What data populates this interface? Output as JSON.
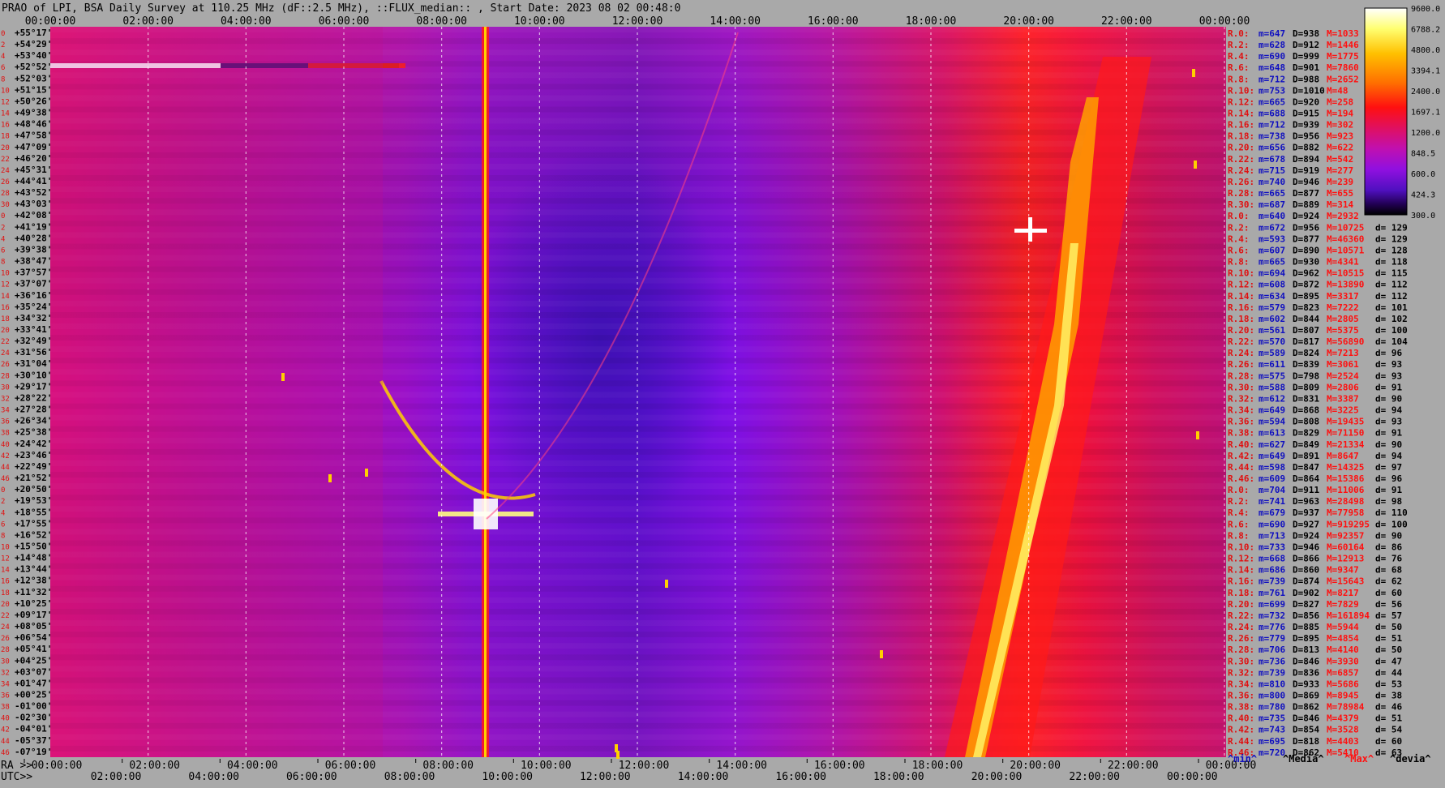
{
  "title": "PRAO of LPI, BSA Daily Survey at 110.25 MHz (dF::2.5 MHz), ::FLUX_median:: , Start Date: 2023 08 02 00:48:0",
  "chart_data": {
    "type": "heatmap",
    "title": "PRAO of LPI, BSA Daily Survey at 110.25 MHz (dF::2.5 MHz), ::FLUX_median:: , Start Date: 2023 08 02 00:48:0",
    "top_axis_ticks": [
      "00:00:00",
      "02:00:00",
      "04:00:00",
      "06:00:00",
      "08:00:00",
      "10:00:00",
      "12:00:00",
      "14:00:00",
      "16:00:00",
      "18:00:00",
      "20:00:00",
      "22:00:00",
      "00:00:00"
    ],
    "bottom_axis_ra_label": "RA >>",
    "bottom_axis_ra_ticks": [
      "00:00:00",
      "02:00:00",
      "04:00:00",
      "06:00:00",
      "08:00:00",
      "10:00:00",
      "12:00:00",
      "14:00:00",
      "16:00:00",
      "18:00:00",
      "20:00:00",
      "22:00:00",
      "00:00:00"
    ],
    "bottom_axis_utc_label": "UTC>>",
    "bottom_axis_utc_ticks": [
      "02:00:00",
      "04:00:00",
      "06:00:00",
      "08:00:00",
      "10:00:00",
      "12:00:00",
      "14:00:00",
      "16:00:00",
      "18:00:00",
      "20:00:00",
      "22:00:00",
      "00:00:00"
    ],
    "declinations": [
      "+55°17'",
      "+54°29'",
      "+53°40'",
      "+52°52'",
      "+52°03'",
      "+51°15'",
      "+50°26'",
      "+49°38'",
      "+48°46'",
      "+47°58'",
      "+47°09'",
      "+46°20'",
      "+45°31'",
      "+44°41'",
      "+43°52'",
      "+43°03'",
      "+42°08'",
      "+41°19'",
      "+40°28'",
      "+39°38'",
      "+38°47'",
      "+37°57'",
      "+37°07'",
      "+36°16'",
      "+35°24'",
      "+34°32'",
      "+33°41'",
      "+32°49'",
      "+31°56'",
      "+31°04'",
      "+30°10'",
      "+29°17'",
      "+28°22'",
      "+27°28'",
      "+26°34'",
      "+25°38'",
      "+24°42'",
      "+23°46'",
      "+22°49'",
      "+21°52'",
      "+20°50'",
      "+19°53'",
      "+18°55'",
      "+17°55'",
      "+16°52'",
      "+15°50'",
      "+14°48'",
      "+13°44'",
      "+12°38'",
      "+11°32'",
      "+10°25'",
      "+09°17'",
      "+08°05'",
      "+06°54'",
      "+05°41'",
      "+04°25'",
      "+03°07'",
      "+01°47'",
      "+00°25'",
      "-01°00'",
      "-02°30'",
      "-04°01'",
      "-05°37'",
      "-07°19'"
    ],
    "row_indices": [
      "0",
      "2",
      "4",
      "6",
      "8",
      "10",
      "12",
      "14",
      "16",
      "18",
      "20",
      "22",
      "24",
      "26",
      "28",
      "30",
      "0",
      "2",
      "4",
      "6",
      "8",
      "10",
      "12",
      "14",
      "16",
      "18",
      "20",
      "22",
      "24",
      "26",
      "28",
      "30",
      "32",
      "34",
      "36",
      "38",
      "40",
      "42",
      "44",
      "46",
      "0",
      "2",
      "4",
      "6",
      "8",
      "10",
      "12",
      "14",
      "16",
      "18",
      "20",
      "22",
      "24",
      "26",
      "28",
      "30",
      "32",
      "34",
      "36",
      "38",
      "40",
      "42",
      "44",
      "46"
    ],
    "colorbar": {
      "ticks": [
        "9600.0",
        "6788.2",
        "4800.0",
        "3394.1",
        "2400.0",
        "1697.1",
        "1200.0",
        "848.5",
        "600.0",
        "424.3",
        "300.0"
      ],
      "min": 300.0,
      "max": 9600.0,
      "colors": [
        "#ffffff",
        "#ffff70",
        "#ffc000",
        "#ff7000",
        "#ff1010",
        "#e01060",
        "#c010b0",
        "#9010e0",
        "#5010c0",
        "#200050",
        "#000000"
      ]
    },
    "stats_rows": [
      {
        "r": "R.0:",
        "m": "m=647",
        "d": "D=938",
        "x": "M=1033",
        "dev": ""
      },
      {
        "r": "R.2:",
        "m": "m=628",
        "d": "D=912",
        "x": "M=1446",
        "dev": ""
      },
      {
        "r": "R.4:",
        "m": "m=690",
        "d": "D=999",
        "x": "M=1775",
        "dev": ""
      },
      {
        "r": "R.6:",
        "m": "m=648",
        "d": "D=901",
        "x": "M=7860",
        "dev": ""
      },
      {
        "r": "R.8:",
        "m": "m=712",
        "d": "D=988",
        "x": "M=2652",
        "dev": ""
      },
      {
        "r": "R.10:",
        "m": "m=753",
        "d": "D=1010",
        "x": "M=48",
        "dev": ""
      },
      {
        "r": "R.12:",
        "m": "m=665",
        "d": "D=920",
        "x": "M=258",
        "dev": ""
      },
      {
        "r": "R.14:",
        "m": "m=688",
        "d": "D=915",
        "x": "M=194",
        "dev": ""
      },
      {
        "r": "R.16:",
        "m": "m=712",
        "d": "D=939",
        "x": "M=302",
        "dev": ""
      },
      {
        "r": "R.18:",
        "m": "m=738",
        "d": "D=956",
        "x": "M=923",
        "dev": ""
      },
      {
        "r": "R.20:",
        "m": "m=656",
        "d": "D=882",
        "x": "M=622",
        "dev": ""
      },
      {
        "r": "R.22:",
        "m": "m=678",
        "d": "D=894",
        "x": "M=542",
        "dev": ""
      },
      {
        "r": "R.24:",
        "m": "m=715",
        "d": "D=919",
        "x": "M=277",
        "dev": ""
      },
      {
        "r": "R.26:",
        "m": "m=740",
        "d": "D=946",
        "x": "M=239",
        "dev": ""
      },
      {
        "r": "R.28:",
        "m": "m=665",
        "d": "D=877",
        "x": "M=655",
        "dev": ""
      },
      {
        "r": "R.30:",
        "m": "m=687",
        "d": "D=889",
        "x": "M=314",
        "dev": ""
      },
      {
        "r": "R.0:",
        "m": "m=640",
        "d": "D=924",
        "x": "M=2932",
        "dev": ""
      },
      {
        "r": "R.2:",
        "m": "m=672",
        "d": "D=956",
        "x": "M=10725",
        "dev": "d= 129"
      },
      {
        "r": "R.4:",
        "m": "m=593",
        "d": "D=877",
        "x": "M=46360",
        "dev": "d= 129"
      },
      {
        "r": "R.6:",
        "m": "m=607",
        "d": "D=890",
        "x": "M=10571",
        "dev": "d= 128"
      },
      {
        "r": "R.8:",
        "m": "m=665",
        "d": "D=930",
        "x": "M=4341",
        "dev": "d= 118"
      },
      {
        "r": "R.10:",
        "m": "m=694",
        "d": "D=962",
        "x": "M=10515",
        "dev": "d= 115"
      },
      {
        "r": "R.12:",
        "m": "m=608",
        "d": "D=872",
        "x": "M=13890",
        "dev": "d= 112"
      },
      {
        "r": "R.14:",
        "m": "m=634",
        "d": "D=895",
        "x": "M=3317",
        "dev": "d= 112"
      },
      {
        "r": "R.16:",
        "m": "m=579",
        "d": "D=823",
        "x": "M=7222",
        "dev": "d= 101"
      },
      {
        "r": "R.18:",
        "m": "m=602",
        "d": "D=844",
        "x": "M=2805",
        "dev": "d= 102"
      },
      {
        "r": "R.20:",
        "m": "m=561",
        "d": "D=807",
        "x": "M=5375",
        "dev": "d= 100"
      },
      {
        "r": "R.22:",
        "m": "m=570",
        "d": "D=817",
        "x": "M=56890",
        "dev": "d= 104"
      },
      {
        "r": "R.24:",
        "m": "m=589",
        "d": "D=824",
        "x": "M=7213",
        "dev": "d= 96"
      },
      {
        "r": "R.26:",
        "m": "m=611",
        "d": "D=839",
        "x": "M=3061",
        "dev": "d= 93"
      },
      {
        "r": "R.28:",
        "m": "m=575",
        "d": "D=798",
        "x": "M=2524",
        "dev": "d= 93"
      },
      {
        "r": "R.30:",
        "m": "m=588",
        "d": "D=809",
        "x": "M=2806",
        "dev": "d= 91"
      },
      {
        "r": "R.32:",
        "m": "m=612",
        "d": "D=831",
        "x": "M=3387",
        "dev": "d= 90"
      },
      {
        "r": "R.34:",
        "m": "m=649",
        "d": "D=868",
        "x": "M=3225",
        "dev": "d= 94"
      },
      {
        "r": "R.36:",
        "m": "m=594",
        "d": "D=808",
        "x": "M=19435",
        "dev": "d= 93"
      },
      {
        "r": "R.38:",
        "m": "m=613",
        "d": "D=829",
        "x": "M=71150",
        "dev": "d= 91"
      },
      {
        "r": "R.40:",
        "m": "m=627",
        "d": "D=849",
        "x": "M=21334",
        "dev": "d= 90"
      },
      {
        "r": "R.42:",
        "m": "m=649",
        "d": "D=891",
        "x": "M=8647",
        "dev": "d= 94"
      },
      {
        "r": "R.44:",
        "m": "m=598",
        "d": "D=847",
        "x": "M=14325",
        "dev": "d= 97"
      },
      {
        "r": "R.46:",
        "m": "m=609",
        "d": "D=864",
        "x": "M=15386",
        "dev": "d= 96"
      },
      {
        "r": "R.0:",
        "m": "m=704",
        "d": "D=911",
        "x": "M=11006",
        "dev": "d= 91"
      },
      {
        "r": "R.2:",
        "m": "m=741",
        "d": "D=963",
        "x": "M=28498",
        "dev": "d= 98"
      },
      {
        "r": "R.4:",
        "m": "m=679",
        "d": "D=937",
        "x": "M=77958",
        "dev": "d= 110"
      },
      {
        "r": "R.6:",
        "m": "m=690",
        "d": "D=927",
        "x": "M=919295",
        "dev": "d= 100"
      },
      {
        "r": "R.8:",
        "m": "m=713",
        "d": "D=924",
        "x": "M=92357",
        "dev": "d= 90"
      },
      {
        "r": "R.10:",
        "m": "m=733",
        "d": "D=946",
        "x": "M=60164",
        "dev": "d= 86"
      },
      {
        "r": "R.12:",
        "m": "m=668",
        "d": "D=866",
        "x": "M=12913",
        "dev": "d= 76"
      },
      {
        "r": "R.14:",
        "m": "m=686",
        "d": "D=860",
        "x": "M=9347",
        "dev": "d= 68"
      },
      {
        "r": "R.16:",
        "m": "m=739",
        "d": "D=874",
        "x": "M=15643",
        "dev": "d= 62"
      },
      {
        "r": "R.18:",
        "m": "m=761",
        "d": "D=902",
        "x": "M=8217",
        "dev": "d= 60"
      },
      {
        "r": "R.20:",
        "m": "m=699",
        "d": "D=827",
        "x": "M=7829",
        "dev": "d= 56"
      },
      {
        "r": "R.22:",
        "m": "m=732",
        "d": "D=856",
        "x": "M=161894",
        "dev": "d= 57"
      },
      {
        "r": "R.24:",
        "m": "m=776",
        "d": "D=885",
        "x": "M=5944",
        "dev": "d= 50"
      },
      {
        "r": "R.26:",
        "m": "m=779",
        "d": "D=895",
        "x": "M=4854",
        "dev": "d= 51"
      },
      {
        "r": "R.28:",
        "m": "m=706",
        "d": "D=813",
        "x": "M=4140",
        "dev": "d= 50"
      },
      {
        "r": "R.30:",
        "m": "m=736",
        "d": "D=846",
        "x": "M=3930",
        "dev": "d= 47"
      },
      {
        "r": "R.32:",
        "m": "m=739",
        "d": "D=836",
        "x": "M=6857",
        "dev": "d= 44"
      },
      {
        "r": "R.34:",
        "m": "m=810",
        "d": "D=933",
        "x": "M=5686",
        "dev": "d= 53"
      },
      {
        "r": "R.36:",
        "m": "m=800",
        "d": "D=869",
        "x": "M=8945",
        "dev": "d= 38"
      },
      {
        "r": "R.38:",
        "m": "m=780",
        "d": "D=862",
        "x": "M=78984",
        "dev": "d= 46"
      },
      {
        "r": "R.40:",
        "m": "m=735",
        "d": "D=846",
        "x": "M=4379",
        "dev": "d= 51"
      },
      {
        "r": "R.42:",
        "m": "m=743",
        "d": "D=854",
        "x": "M=3528",
        "dev": "d= 54"
      },
      {
        "r": "R.44:",
        "m": "m=695",
        "d": "D=818",
        "x": "M=4403",
        "dev": "d= 60"
      },
      {
        "r": "R.46:",
        "m": "m=720",
        "d": "D=862",
        "x": "M=5410",
        "dev": "d= 63"
      }
    ],
    "stats_legend": {
      "min": "^min^",
      "median": "^Media^",
      "max": "^Max^",
      "devia": "^devia^"
    },
    "colors": {
      "background": "#a9a9a9",
      "heat_purple": "#8a10e8",
      "heat_magenta": "#c0108c",
      "heat_red": "#ff1a1a",
      "stats_label": "#e01010",
      "stats_text": "#1010c0",
      "stats_max": "#ff1010",
      "dev_text": "#000000"
    }
  }
}
